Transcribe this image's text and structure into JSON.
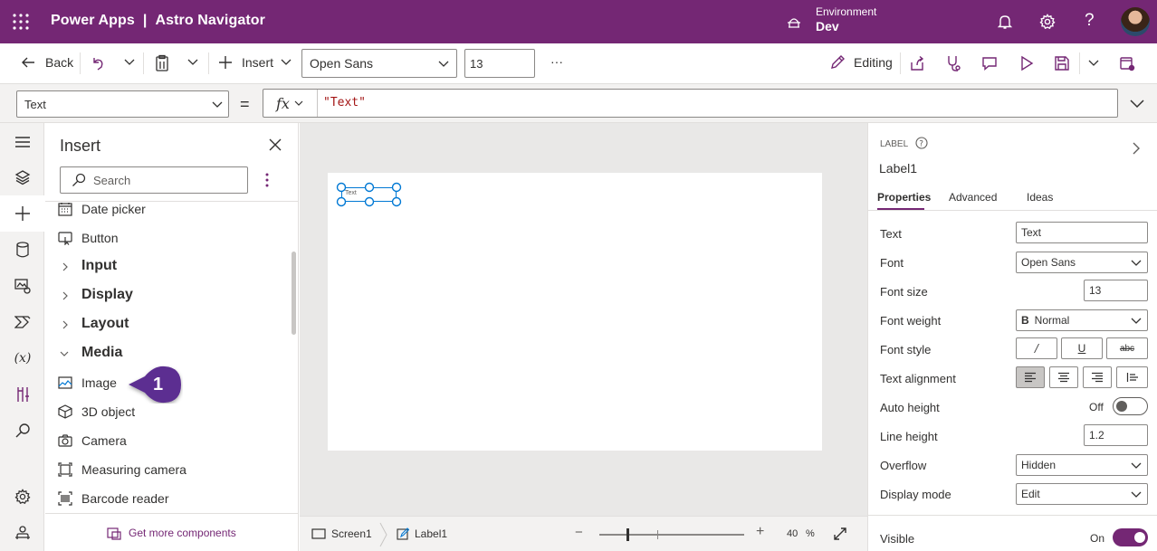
{
  "topbar": {
    "app_name": "Power Apps",
    "separator": "|",
    "project": "Astro Navigator",
    "environment_label": "Environment",
    "environment_value": "Dev"
  },
  "command_bar": {
    "back_label": "Back",
    "insert_label": "Insert",
    "font_value": "Open Sans",
    "font_size_value": "13",
    "more_label": "···",
    "editing_label": "Editing"
  },
  "formula_bar": {
    "property_value": "Text",
    "equals": "=",
    "fx_label": "fx",
    "formula_value": "\"Text\""
  },
  "insert_pane": {
    "title": "Insert",
    "search_placeholder": "Search",
    "items": [
      {
        "label": "Date picker",
        "icon": "calendar-icon",
        "type": "item"
      },
      {
        "label": "Button",
        "icon": "button-icon",
        "type": "item"
      },
      {
        "label": "Input",
        "icon": "chevron-right-icon",
        "type": "group"
      },
      {
        "label": "Display",
        "icon": "chevron-right-icon",
        "type": "group"
      },
      {
        "label": "Layout",
        "icon": "chevron-right-icon",
        "type": "group"
      },
      {
        "label": "Media",
        "icon": "chevron-down-icon",
        "type": "group"
      },
      {
        "label": "Image",
        "icon": "image-icon",
        "type": "item"
      },
      {
        "label": "3D object",
        "icon": "cube-icon",
        "type": "item"
      },
      {
        "label": "Camera",
        "icon": "camera-icon",
        "type": "item"
      },
      {
        "label": "Measuring camera",
        "icon": "measure-icon",
        "type": "item"
      },
      {
        "label": "Barcode reader",
        "icon": "barcode-icon",
        "type": "item"
      }
    ],
    "callout_number": "1",
    "footer_link": "Get more components"
  },
  "canvas": {
    "label_text": "Text"
  },
  "bottom_bar": {
    "screen_crumb": "Screen1",
    "label_crumb": "Label1",
    "zoom_minus": "−",
    "zoom_plus": "+",
    "zoom_value": "40",
    "zoom_unit": "%",
    "zoom_level": 0.4
  },
  "right_panel": {
    "type_label": "LABEL",
    "control_name": "Label1",
    "tabs": [
      "Properties",
      "Advanced",
      "Ideas"
    ],
    "properties": {
      "text_label": "Text",
      "text_value": "Text",
      "font_label": "Font",
      "font_value": "Open Sans",
      "font_size_label": "Font size",
      "font_size_value": "13",
      "font_weight_label": "Font weight",
      "font_weight_icon": "B",
      "font_weight_value": "Normal",
      "font_style_label": "Font style",
      "text_alignment_label": "Text alignment",
      "auto_height_label": "Auto height",
      "auto_height_value": "Off",
      "line_height_label": "Line height",
      "line_height_value": "1.2",
      "overflow_label": "Overflow",
      "overflow_value": "Hidden",
      "display_mode_label": "Display mode",
      "display_mode_value": "Edit",
      "visible_label": "Visible",
      "visible_value": "On"
    }
  },
  "colors": {
    "brand": "#742774",
    "accent_blue": "#0078d4",
    "callout": "#5c2d91"
  }
}
